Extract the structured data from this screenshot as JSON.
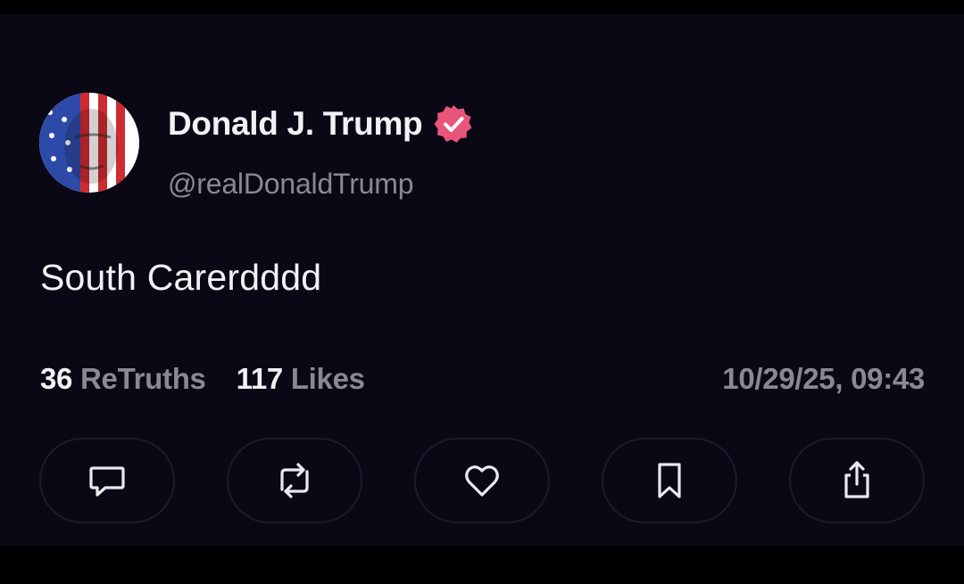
{
  "post": {
    "author": {
      "display_name": "Donald J. Trump",
      "handle": "@realDonaldTrump",
      "verified": true,
      "verified_icon": "verified-badge-icon",
      "verified_color": "#e8557a"
    },
    "text": "South Carerdddd",
    "stats": {
      "retruths_count": "36",
      "retruths_label": "ReTruths",
      "likes_count": "117",
      "likes_label": "Likes"
    },
    "timestamp": "10/29/25, 09:43"
  },
  "actions": [
    {
      "name": "reply",
      "icon": "comment-icon"
    },
    {
      "name": "retruth",
      "icon": "retruth-icon"
    },
    {
      "name": "like",
      "icon": "heart-icon"
    },
    {
      "name": "bookmark",
      "icon": "bookmark-icon"
    },
    {
      "name": "share",
      "icon": "share-icon"
    }
  ],
  "colors": {
    "background": "#0b0816",
    "text_primary": "#f2f2f5",
    "text_secondary": "#8a8894",
    "button_border": "#1d1a2c"
  }
}
